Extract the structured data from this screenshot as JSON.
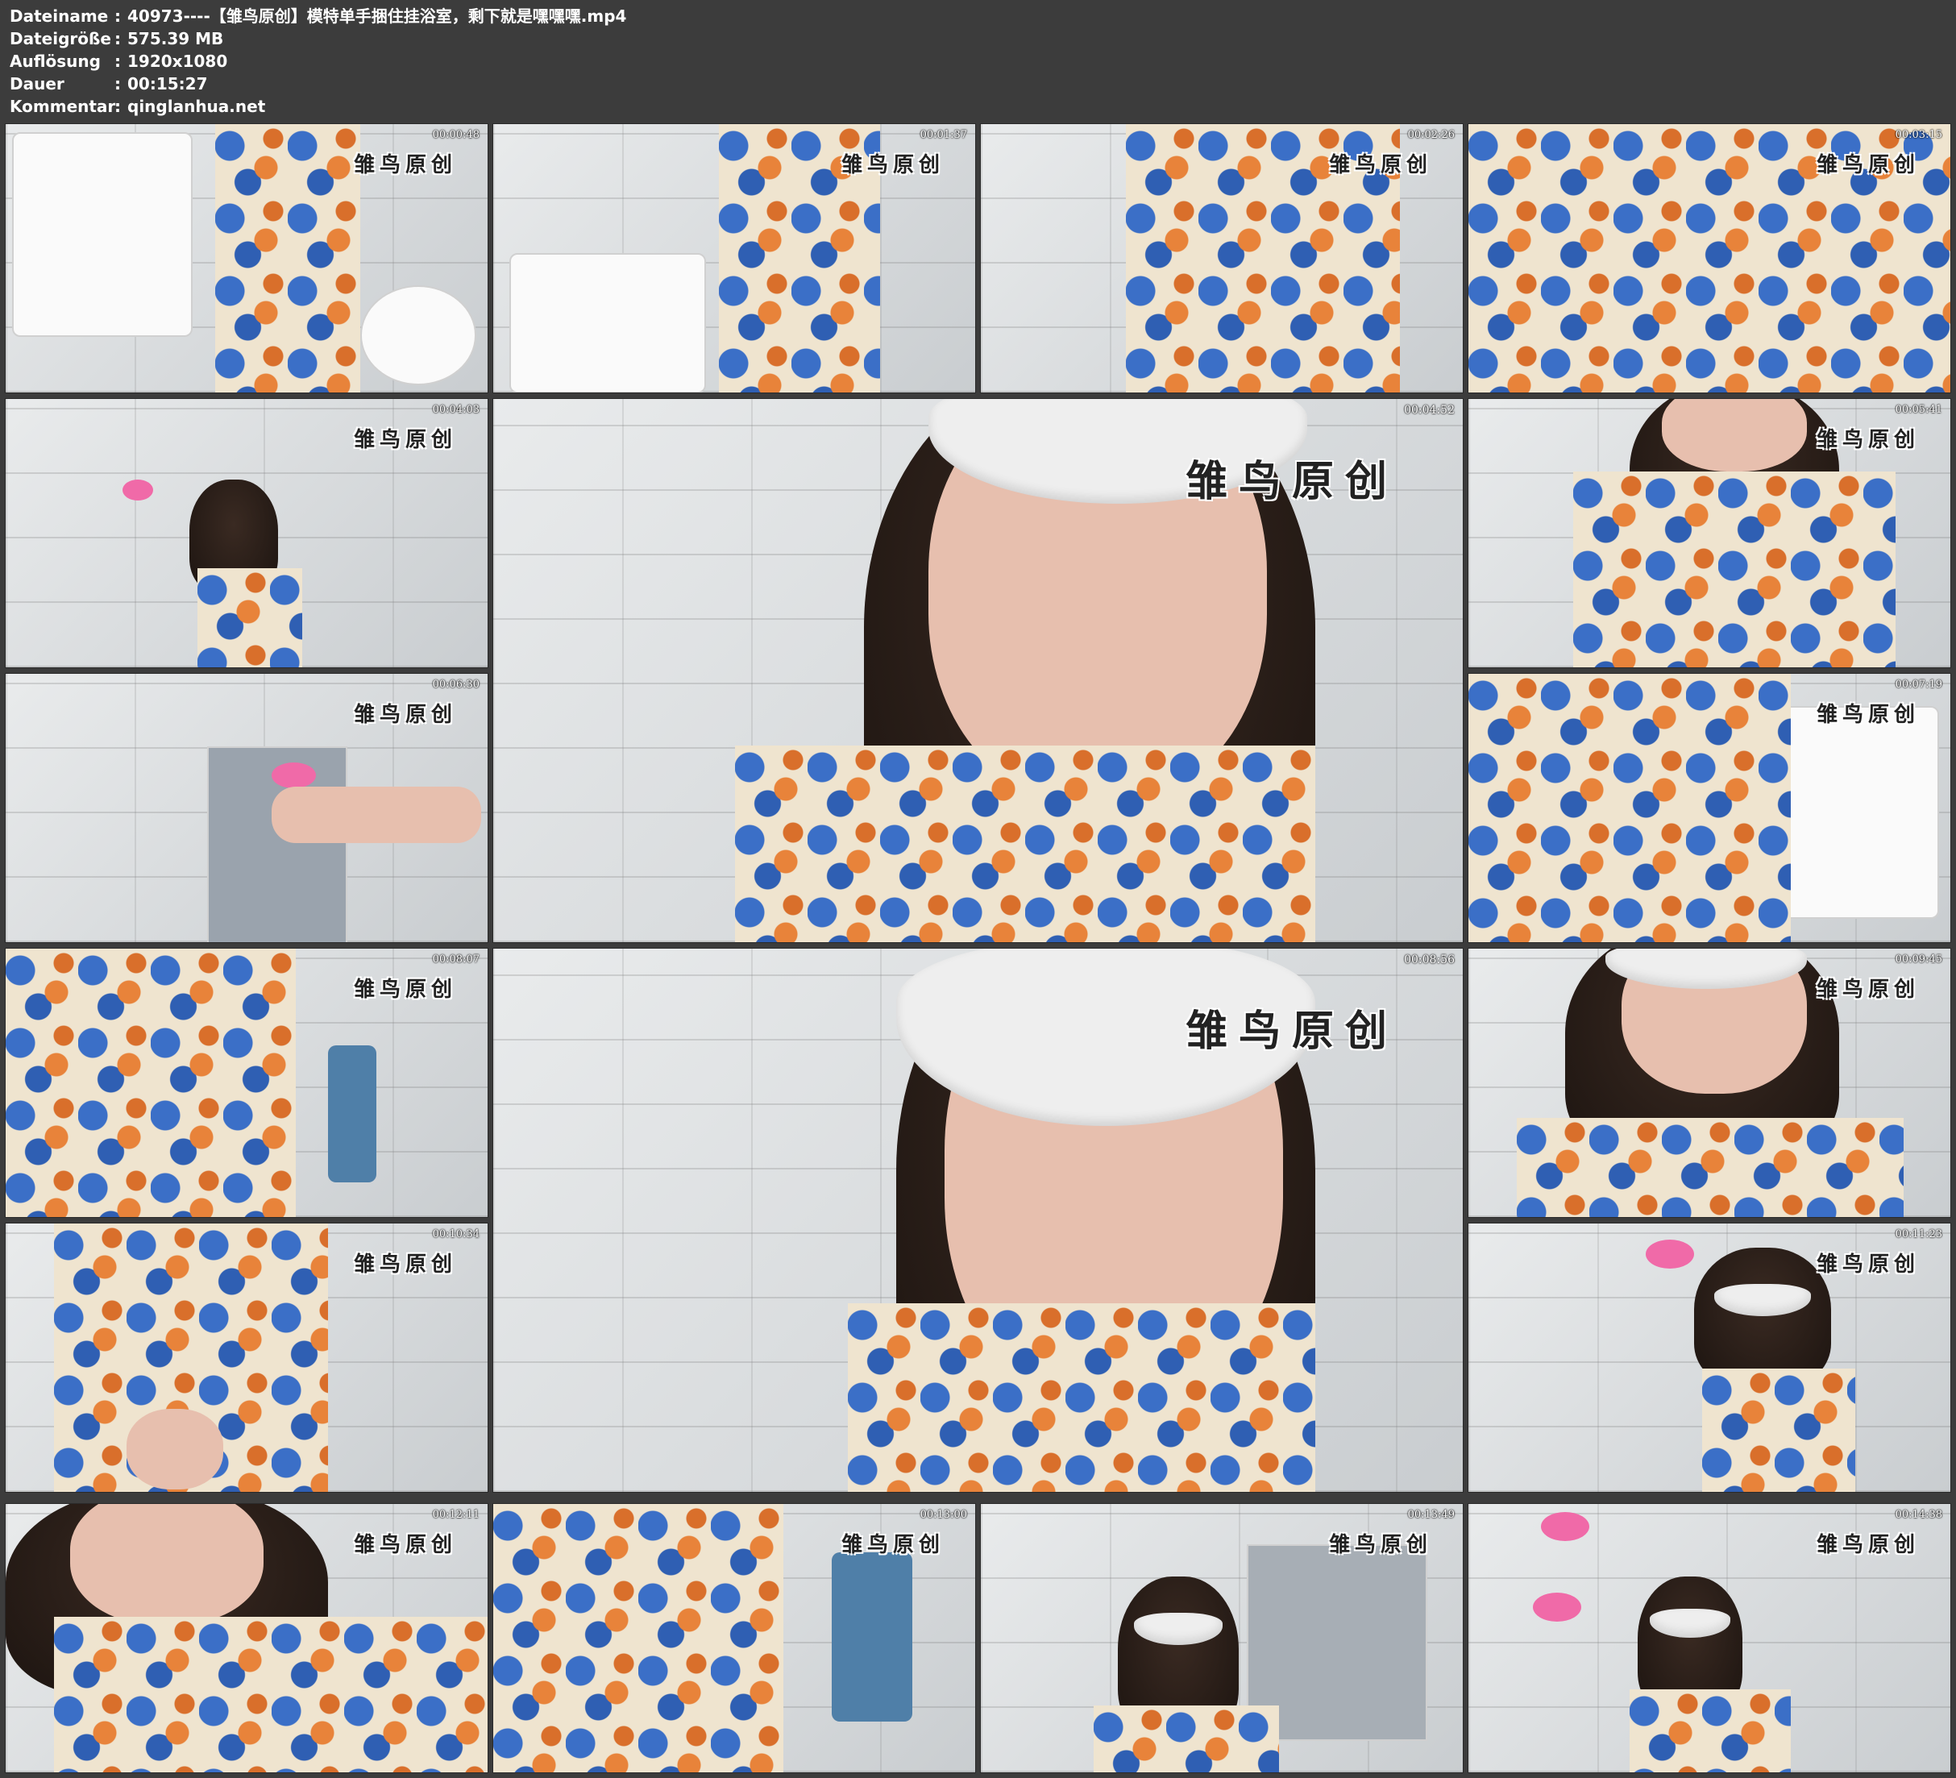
{
  "header": {
    "rows": [
      {
        "key": "Dateiname",
        "value": "40973----【雏鸟原创】模特单手捆住挂浴室，剩下就是嘿嘿嘿.mp4"
      },
      {
        "key": "Dateigröße",
        "value": "575.39 MB"
      },
      {
        "key": "Auflösung",
        "value": "1920x1080"
      },
      {
        "key": "Dauer",
        "value": "00:15:27"
      },
      {
        "key": "Kommentar",
        "value": "qinglanhua.net"
      }
    ],
    "separator": ":"
  },
  "watermark": "雏鸟原创",
  "thumbnails": [
    {
      "time": "00:00:48",
      "scene": "bathroom-sink-dress"
    },
    {
      "time": "00:01:37",
      "scene": "bathroom-sink-dress"
    },
    {
      "time": "00:02:26",
      "scene": "dress-closeup"
    },
    {
      "time": "00:03:15",
      "scene": "dress-closeup"
    },
    {
      "time": "00:04:03",
      "scene": "cuffed-wall"
    },
    {
      "time": "00:04:52",
      "scene": "blindfold-closeup-large"
    },
    {
      "time": "00:05:41",
      "scene": "face-closeup"
    },
    {
      "time": "00:06:30",
      "scene": "cuffed-arm-mirror"
    },
    {
      "time": "00:07:19",
      "scene": "dress-sink"
    },
    {
      "time": "00:08:07",
      "scene": "dress-closeup"
    },
    {
      "time": "00:08:56",
      "scene": "blindfold-closeup-large"
    },
    {
      "time": "00:09:45",
      "scene": "blindfold-face"
    },
    {
      "time": "00:10:34",
      "scene": "dress-hand"
    },
    {
      "time": "00:11:23",
      "scene": "cuffed-wall-blindfold"
    },
    {
      "time": "00:12:11",
      "scene": "face-closeup"
    },
    {
      "time": "00:13:00",
      "scene": "dress-towel"
    },
    {
      "time": "00:13:49",
      "scene": "blindfold-mirror"
    },
    {
      "time": "00:14:38",
      "scene": "cuffed-wall-blindfold"
    }
  ]
}
